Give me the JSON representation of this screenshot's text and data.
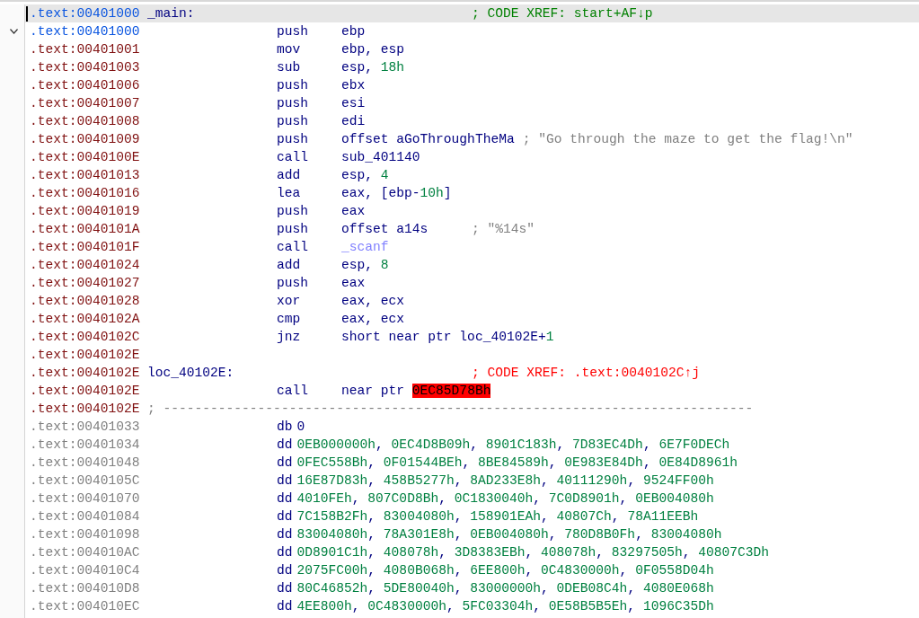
{
  "listing": {
    "rows": [
      {
        "kind": "label",
        "selected": true,
        "address": {
          "text": ".text:00401000",
          "color": "#0a55e0"
        },
        "label": "_main:",
        "comment": {
          "text": "; CODE XREF: start+AF↓p",
          "kind": "xref"
        }
      },
      {
        "kind": "code",
        "selected": false,
        "expanded": true,
        "address": {
          "text": ".text:00401000",
          "color": "#0a55e0"
        },
        "mnemonic": "push",
        "operands": [
          {
            "text": "ebp",
            "kind": "reg"
          }
        ]
      },
      {
        "kind": "code",
        "selected": false,
        "address": {
          "text": ".text:00401001",
          "color": "#801010"
        },
        "mnemonic": "mov",
        "operands": [
          {
            "text": "ebp, esp",
            "kind": "reg"
          }
        ]
      },
      {
        "kind": "code",
        "selected": false,
        "address": {
          "text": ".text:00401003",
          "color": "#801010"
        },
        "mnemonic": "sub",
        "operands": [
          {
            "text": "esp, ",
            "kind": "reg"
          },
          {
            "text": "18h",
            "kind": "num"
          }
        ]
      },
      {
        "kind": "code",
        "selected": false,
        "address": {
          "text": ".text:00401006",
          "color": "#801010"
        },
        "mnemonic": "push",
        "operands": [
          {
            "text": "ebx",
            "kind": "reg"
          }
        ]
      },
      {
        "kind": "code",
        "selected": false,
        "address": {
          "text": ".text:00401007",
          "color": "#801010"
        },
        "mnemonic": "push",
        "operands": [
          {
            "text": "esi",
            "kind": "reg"
          }
        ]
      },
      {
        "kind": "code",
        "selected": false,
        "address": {
          "text": ".text:00401008",
          "color": "#801010"
        },
        "mnemonic": "push",
        "operands": [
          {
            "text": "edi",
            "kind": "reg"
          }
        ]
      },
      {
        "kind": "code",
        "selected": false,
        "address": {
          "text": ".text:00401009",
          "color": "#801010"
        },
        "mnemonic": "push",
        "operands": [
          {
            "text": "offset aGoThroughTheMa",
            "kind": "name"
          }
        ],
        "comment": {
          "text": "; \"Go through the maze to get the flag!\\n\"",
          "kind": "string"
        }
      },
      {
        "kind": "code",
        "selected": false,
        "address": {
          "text": ".text:0040100E",
          "color": "#801010"
        },
        "mnemonic": "call",
        "operands": [
          {
            "text": "sub_401140",
            "kind": "name"
          }
        ]
      },
      {
        "kind": "code",
        "selected": false,
        "address": {
          "text": ".text:00401013",
          "color": "#801010"
        },
        "mnemonic": "add",
        "operands": [
          {
            "text": "esp, ",
            "kind": "reg"
          },
          {
            "text": "4",
            "kind": "num"
          }
        ]
      },
      {
        "kind": "code",
        "selected": false,
        "address": {
          "text": ".text:00401016",
          "color": "#801010"
        },
        "mnemonic": "lea",
        "operands": [
          {
            "text": "eax, [ebp-",
            "kind": "reg"
          },
          {
            "text": "10h",
            "kind": "num"
          },
          {
            "text": "]",
            "kind": "reg"
          }
        ]
      },
      {
        "kind": "code",
        "selected": false,
        "address": {
          "text": ".text:00401019",
          "color": "#801010"
        },
        "mnemonic": "push",
        "operands": [
          {
            "text": "eax",
            "kind": "reg"
          }
        ]
      },
      {
        "kind": "code",
        "selected": false,
        "address": {
          "text": ".text:0040101A",
          "color": "#801010"
        },
        "mnemonic": "push",
        "operands": [
          {
            "text": "offset a14s",
            "kind": "name"
          }
        ],
        "comment": {
          "text": "; \"%14s\"",
          "kind": "string"
        }
      },
      {
        "kind": "code",
        "selected": false,
        "address": {
          "text": ".text:0040101F",
          "color": "#801010"
        },
        "mnemonic": "call",
        "operands": [
          {
            "text": "_scanf",
            "kind": "import"
          }
        ]
      },
      {
        "kind": "code",
        "selected": false,
        "address": {
          "text": ".text:00401024",
          "color": "#801010"
        },
        "mnemonic": "add",
        "operands": [
          {
            "text": "esp, ",
            "kind": "reg"
          },
          {
            "text": "8",
            "kind": "num"
          }
        ]
      },
      {
        "kind": "code",
        "selected": false,
        "address": {
          "text": ".text:00401027",
          "color": "#801010"
        },
        "mnemonic": "push",
        "operands": [
          {
            "text": "eax",
            "kind": "reg"
          }
        ]
      },
      {
        "kind": "code",
        "selected": false,
        "address": {
          "text": ".text:00401028",
          "color": "#801010"
        },
        "mnemonic": "xor",
        "operands": [
          {
            "text": "eax, ecx",
            "kind": "reg"
          }
        ]
      },
      {
        "kind": "code",
        "selected": false,
        "address": {
          "text": ".text:0040102A",
          "color": "#801010"
        },
        "mnemonic": "cmp",
        "operands": [
          {
            "text": "eax, ecx",
            "kind": "reg"
          }
        ]
      },
      {
        "kind": "code",
        "selected": false,
        "address": {
          "text": ".text:0040102C",
          "color": "#801010"
        },
        "mnemonic": "jnz",
        "operands": [
          {
            "text": "short near ptr loc_40102E+",
            "kind": "name"
          },
          {
            "text": "1",
            "kind": "num"
          }
        ]
      },
      {
        "kind": "blank",
        "selected": false,
        "address": {
          "text": ".text:0040102E",
          "color": "#801010"
        }
      },
      {
        "kind": "label",
        "selected": false,
        "address": {
          "text": ".text:0040102E",
          "color": "#801010"
        },
        "label": "loc_40102E:",
        "comment": {
          "text": "; CODE XREF: .text:0040102C↑j",
          "kind": "xref_error"
        }
      },
      {
        "kind": "code",
        "selected": false,
        "address": {
          "text": ".text:0040102E",
          "color": "#801010"
        },
        "mnemonic": "call",
        "operands": [
          {
            "text": "near ptr ",
            "kind": "name"
          },
          {
            "text": "0EC85D78Bh",
            "kind": "error"
          }
        ]
      },
      {
        "kind": "separator",
        "selected": false,
        "address": {
          "text": ".text:0040102E",
          "color": "#801010"
        },
        "comment": {
          "text": "; ---------------------------------------------------------------------------",
          "kind": "string"
        }
      },
      {
        "kind": "data",
        "selected": false,
        "address": {
          "text": ".text:00401033",
          "color": "#808080"
        },
        "mnemonic": "db",
        "operands": [
          {
            "text": "0",
            "kind": "name"
          }
        ]
      },
      {
        "kind": "data",
        "selected": false,
        "address": {
          "text": ".text:00401034",
          "color": "#808080"
        },
        "mnemonic": "dd",
        "operands": [
          {
            "text": "0EB000000h",
            "kind": "num"
          },
          {
            "text": ", ",
            "kind": "punct"
          },
          {
            "text": "0EC4D8B09h",
            "kind": "num"
          },
          {
            "text": ", ",
            "kind": "punct"
          },
          {
            "text": "8901C183h",
            "kind": "num"
          },
          {
            "text": ", ",
            "kind": "punct"
          },
          {
            "text": "7D83EC4Dh",
            "kind": "num"
          },
          {
            "text": ", ",
            "kind": "punct"
          },
          {
            "text": "6E7F0DECh",
            "kind": "num"
          }
        ]
      },
      {
        "kind": "data",
        "selected": false,
        "address": {
          "text": ".text:00401048",
          "color": "#808080"
        },
        "mnemonic": "dd",
        "operands": [
          {
            "text": "0FEC558Bh",
            "kind": "num"
          },
          {
            "text": ", ",
            "kind": "punct"
          },
          {
            "text": "0F01544BEh",
            "kind": "num"
          },
          {
            "text": ", ",
            "kind": "punct"
          },
          {
            "text": "8BE84589h",
            "kind": "num"
          },
          {
            "text": ", ",
            "kind": "punct"
          },
          {
            "text": "0E983E84Dh",
            "kind": "num"
          },
          {
            "text": ", ",
            "kind": "punct"
          },
          {
            "text": "0E84D8961h",
            "kind": "num"
          }
        ]
      },
      {
        "kind": "data",
        "selected": false,
        "address": {
          "text": ".text:0040105C",
          "color": "#808080"
        },
        "mnemonic": "dd",
        "operands": [
          {
            "text": "16E87D83h",
            "kind": "num"
          },
          {
            "text": ", ",
            "kind": "punct"
          },
          {
            "text": "458B5277h",
            "kind": "num"
          },
          {
            "text": ", ",
            "kind": "punct"
          },
          {
            "text": "8AD233E8h",
            "kind": "num"
          },
          {
            "text": ", ",
            "kind": "punct"
          },
          {
            "text": "40111290h",
            "kind": "num"
          },
          {
            "text": ", ",
            "kind": "punct"
          },
          {
            "text": "9524FF00h",
            "kind": "num"
          }
        ]
      },
      {
        "kind": "data",
        "selected": false,
        "address": {
          "text": ".text:00401070",
          "color": "#808080"
        },
        "mnemonic": "dd",
        "operands": [
          {
            "text": "4010FEh",
            "kind": "num"
          },
          {
            "text": ", ",
            "kind": "punct"
          },
          {
            "text": "807C0D8Bh",
            "kind": "num"
          },
          {
            "text": ", ",
            "kind": "punct"
          },
          {
            "text": "0C1830040h",
            "kind": "num"
          },
          {
            "text": ", ",
            "kind": "punct"
          },
          {
            "text": "7C0D8901h",
            "kind": "num"
          },
          {
            "text": ", ",
            "kind": "punct"
          },
          {
            "text": "0EB004080h",
            "kind": "num"
          }
        ]
      },
      {
        "kind": "data",
        "selected": false,
        "address": {
          "text": ".text:00401084",
          "color": "#808080"
        },
        "mnemonic": "dd",
        "operands": [
          {
            "text": "7C158B2Fh",
            "kind": "num"
          },
          {
            "text": ", ",
            "kind": "punct"
          },
          {
            "text": "83004080h",
            "kind": "num"
          },
          {
            "text": ", ",
            "kind": "punct"
          },
          {
            "text": "158901EAh",
            "kind": "num"
          },
          {
            "text": ", ",
            "kind": "punct"
          },
          {
            "text": "40807Ch",
            "kind": "num"
          },
          {
            "text": ", ",
            "kind": "punct"
          },
          {
            "text": "78A11EEBh",
            "kind": "num"
          }
        ]
      },
      {
        "kind": "data",
        "selected": false,
        "address": {
          "text": ".text:00401098",
          "color": "#808080"
        },
        "mnemonic": "dd",
        "operands": [
          {
            "text": "83004080h",
            "kind": "num"
          },
          {
            "text": ", ",
            "kind": "punct"
          },
          {
            "text": "78A301E8h",
            "kind": "num"
          },
          {
            "text": ", ",
            "kind": "punct"
          },
          {
            "text": "0EB004080h",
            "kind": "num"
          },
          {
            "text": ", ",
            "kind": "punct"
          },
          {
            "text": "780D8B0Fh",
            "kind": "num"
          },
          {
            "text": ", ",
            "kind": "punct"
          },
          {
            "text": "83004080h",
            "kind": "num"
          }
        ]
      },
      {
        "kind": "data",
        "selected": false,
        "address": {
          "text": ".text:004010AC",
          "color": "#808080"
        },
        "mnemonic": "dd",
        "operands": [
          {
            "text": "0D8901C1h",
            "kind": "num"
          },
          {
            "text": ", ",
            "kind": "punct"
          },
          {
            "text": "408078h",
            "kind": "num"
          },
          {
            "text": ", ",
            "kind": "punct"
          },
          {
            "text": "3D8383EBh",
            "kind": "num"
          },
          {
            "text": ", ",
            "kind": "punct"
          },
          {
            "text": "408078h",
            "kind": "num"
          },
          {
            "text": ", ",
            "kind": "punct"
          },
          {
            "text": "83297505h",
            "kind": "num"
          },
          {
            "text": ", ",
            "kind": "punct"
          },
          {
            "text": "40807C3Dh",
            "kind": "num"
          }
        ]
      },
      {
        "kind": "data",
        "selected": false,
        "address": {
          "text": ".text:004010C4",
          "color": "#808080"
        },
        "mnemonic": "dd",
        "operands": [
          {
            "text": "2075FC00h",
            "kind": "num"
          },
          {
            "text": ", ",
            "kind": "punct"
          },
          {
            "text": "4080B068h",
            "kind": "num"
          },
          {
            "text": ", ",
            "kind": "punct"
          },
          {
            "text": "6EE800h",
            "kind": "num"
          },
          {
            "text": ", ",
            "kind": "punct"
          },
          {
            "text": "0C4830000h",
            "kind": "num"
          },
          {
            "text": ", ",
            "kind": "punct"
          },
          {
            "text": "0F0558D04h",
            "kind": "num"
          }
        ]
      },
      {
        "kind": "data",
        "selected": false,
        "address": {
          "text": ".text:004010D8",
          "color": "#808080"
        },
        "mnemonic": "dd",
        "operands": [
          {
            "text": "80C46852h",
            "kind": "num"
          },
          {
            "text": ", ",
            "kind": "punct"
          },
          {
            "text": "5DE80040h",
            "kind": "num"
          },
          {
            "text": ", ",
            "kind": "punct"
          },
          {
            "text": "83000000h",
            "kind": "num"
          },
          {
            "text": ", ",
            "kind": "punct"
          },
          {
            "text": "0DEB08C4h",
            "kind": "num"
          },
          {
            "text": ", ",
            "kind": "punct"
          },
          {
            "text": "4080E068h",
            "kind": "num"
          }
        ]
      },
      {
        "kind": "data",
        "selected": false,
        "address": {
          "text": ".text:004010EC",
          "color": "#808080"
        },
        "mnemonic": "dd",
        "operands": [
          {
            "text": "4EE800h",
            "kind": "num"
          },
          {
            "text": ", ",
            "kind": "punct"
          },
          {
            "text": "0C4830000h",
            "kind": "num"
          },
          {
            "text": ", ",
            "kind": "punct"
          },
          {
            "text": "5FC03304h",
            "kind": "num"
          },
          {
            "text": ", ",
            "kind": "punct"
          },
          {
            "text": "0E58B5B5Eh",
            "kind": "num"
          },
          {
            "text": ", ",
            "kind": "punct"
          },
          {
            "text": "1096C35Dh",
            "kind": "num"
          }
        ]
      }
    ]
  }
}
